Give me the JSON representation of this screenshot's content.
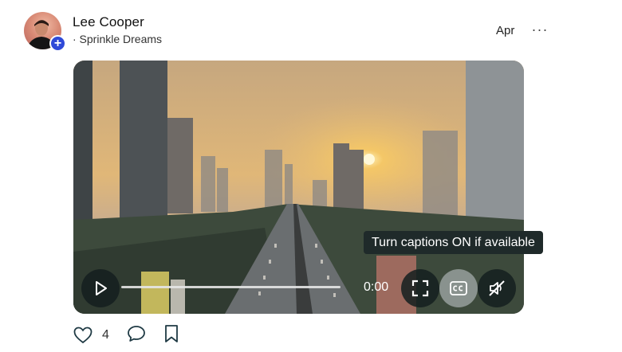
{
  "author": {
    "name": "Lee Cooper",
    "community": "· Sprinkle Dreams"
  },
  "post": {
    "date": "Apr",
    "more_label": "···"
  },
  "video": {
    "current_time": "0:00",
    "progress": 0,
    "tooltip": "Turn captions ON if available",
    "controls": [
      "play-icon",
      "fullscreen-icon",
      "captions-icon",
      "muted-icon"
    ]
  },
  "actions": {
    "like_count": "4"
  },
  "colors": {
    "avatar_badge": "#2f4ad8",
    "control_bg": "#1e2828",
    "tooltip_bg": "#1f2a2a"
  }
}
